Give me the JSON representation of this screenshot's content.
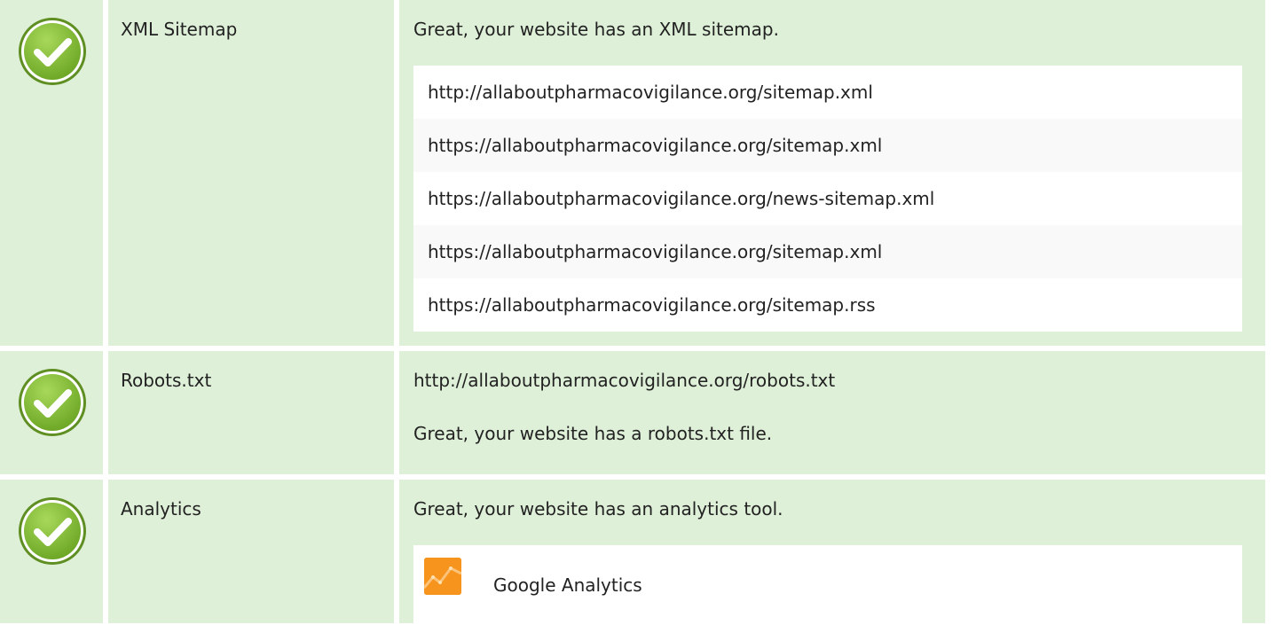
{
  "colors": {
    "row_background": "#dff0d8",
    "check_green": "#8cc63e",
    "analytics_orange": "#f7941d"
  },
  "rows": [
    {
      "icon": "check-circle-icon",
      "label": "XML Sitemap",
      "message": "Great, your website has an XML sitemap.",
      "urls": [
        "http://allaboutpharmacovigilance.org/sitemap.xml",
        "https://allaboutpharmacovigilance.org/sitemap.xml",
        "https://allaboutpharmacovigilance.org/news-sitemap.xml",
        "https://allaboutpharmacovigilance.org/sitemap.xml",
        "https://allaboutpharmacovigilance.org/sitemap.rss"
      ]
    },
    {
      "icon": "check-circle-icon",
      "label": "Robots.txt",
      "url": "http://allaboutpharmacovigilance.org/robots.txt",
      "message": "Great, your website has a robots.txt file."
    },
    {
      "icon": "check-circle-icon",
      "label": "Analytics",
      "message": "Great, your website has an analytics tool.",
      "tool": {
        "icon": "google-analytics-icon",
        "name": "Google Analytics"
      }
    }
  ]
}
